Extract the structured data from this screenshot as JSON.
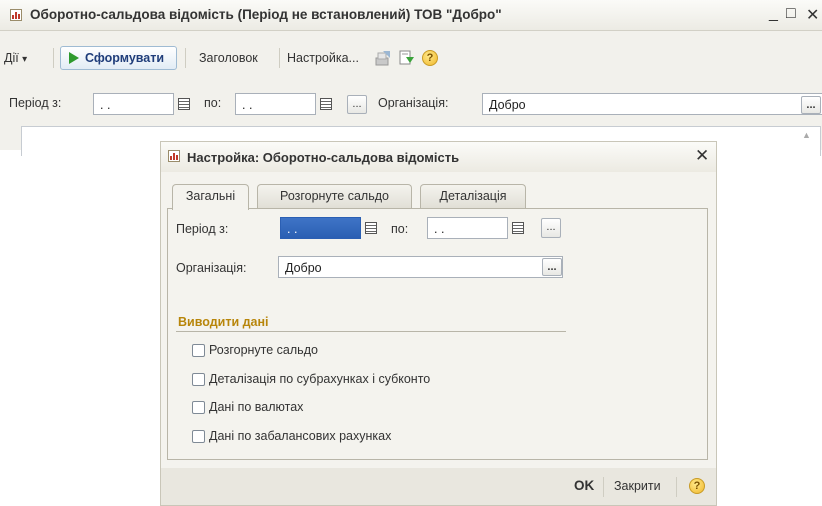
{
  "main_window": {
    "title": "Оборотно-сальдова відомість (Період не встановлений) ТОВ \"Добро\"",
    "controls": {
      "minimize": "_",
      "maximize": "□",
      "close": "✕"
    },
    "toolbar": {
      "actions_label": "Дії",
      "actions_arrow": "▾",
      "generate_label": "Сформувати",
      "header_label": "Заголовок",
      "settings_label": "Настройка...",
      "help_glyph": "?"
    },
    "filters": {
      "period_from_label": "Період з:",
      "period_from_value": ". .",
      "period_to_label": "по:",
      "period_to_value": ". .",
      "period_select_glyph": "...",
      "organization_label": "Організація:",
      "organization_value": "Добро",
      "organization_select_glyph": "..."
    },
    "scroll_up_glyph": "▲"
  },
  "dialog": {
    "title": "Настройка: Оборотно-сальдова відомість",
    "close_glyph": "✕",
    "tabs": [
      {
        "label": "Загальні",
        "active": true
      },
      {
        "label": "Розгорнуте сальдо",
        "active": false
      },
      {
        "label": "Деталізація",
        "active": false
      }
    ],
    "general": {
      "period_from_label": "Період з:",
      "period_from_value": ". .",
      "period_to_label": "по:",
      "period_to_value": ". .",
      "period_select_glyph": "...",
      "organization_label": "Організація:",
      "organization_value": "Добро",
      "organization_select_glyph": "...",
      "section_title": "Виводити дані",
      "options": [
        {
          "label": "Розгорнуте сальдо",
          "checked": false
        },
        {
          "label": "Деталізація по субрахунках і субконто",
          "checked": false
        },
        {
          "label": "Дані по валютах",
          "checked": false
        },
        {
          "label": "Дані по забалансових рахунках",
          "checked": false
        }
      ]
    },
    "footer": {
      "ok_label": "OK",
      "close_label": "Закрити",
      "help_glyph": "?"
    }
  },
  "colors": {
    "accent_blue": "#2b5fb3",
    "section_gold": "#b8860b",
    "play_green": "#2e9a2e"
  }
}
